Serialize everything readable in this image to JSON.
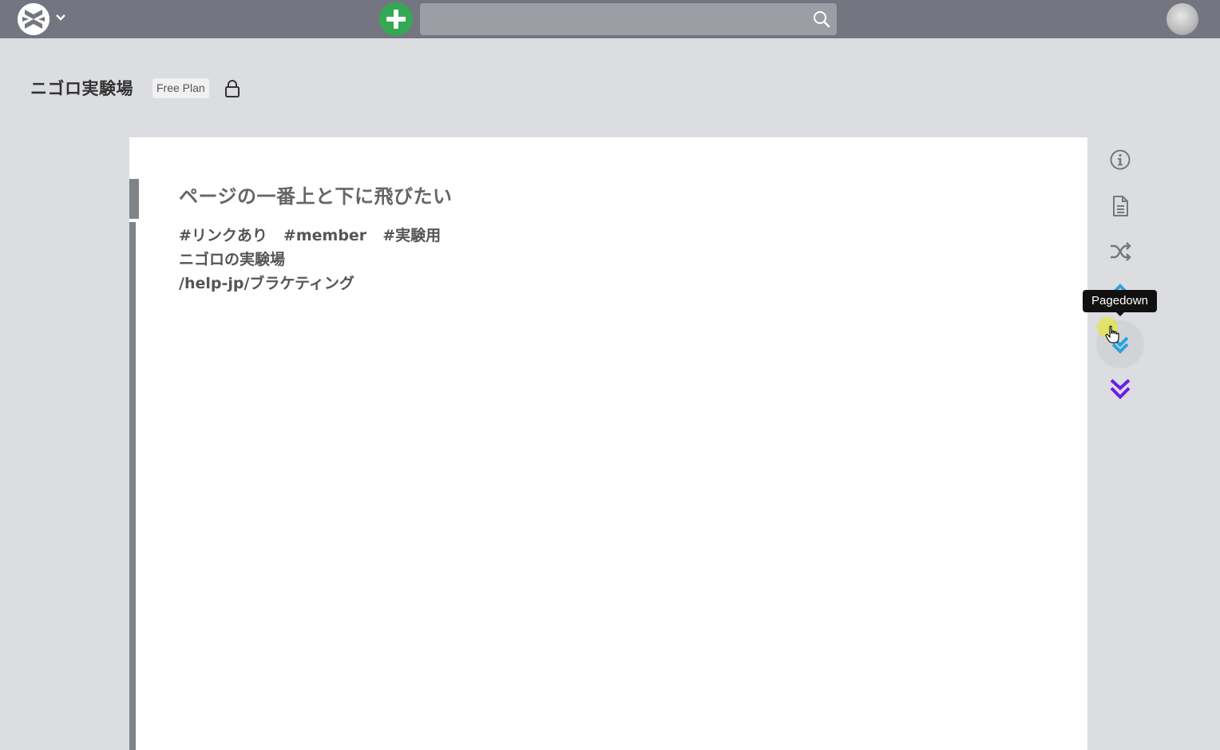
{
  "navbar": {
    "search": {
      "value": "",
      "placeholder": ""
    }
  },
  "project": {
    "title": "ニゴロ実験場",
    "plan_badge": "Free Plan"
  },
  "page": {
    "title": "ページの一番上と下に飛びたい",
    "tags": [
      "#リンクあり",
      "#member",
      "#実験用"
    ],
    "line2": "ニゴロの実験場",
    "line3": "/help-jp/ブラケティング"
  },
  "toolbar": {
    "tooltip": "Pagedown",
    "colors": {
      "pageup": "#29a3e0",
      "pagedown": "#29a3e0",
      "bottom": "#6a1de5",
      "icons": "#777777"
    },
    "icons": [
      "info-icon",
      "document-icon",
      "shuffle-icon",
      "chevron-up-icon",
      "chevron-down-icon",
      "double-chevron-down-icon"
    ]
  }
}
